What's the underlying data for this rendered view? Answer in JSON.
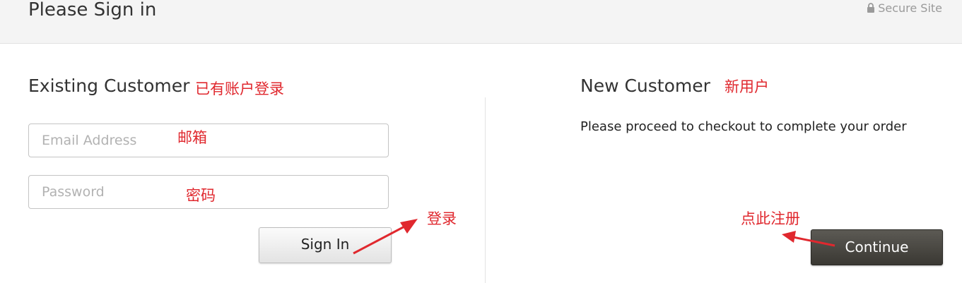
{
  "header": {
    "title": "Please Sign in",
    "secure_label": "Secure Site",
    "secure_icon": "lock-icon"
  },
  "existing": {
    "heading": "Existing Customer",
    "annotation": "已有账户登录",
    "email_placeholder": "Email Address",
    "email_annotation": "邮箱",
    "password_placeholder": "Password",
    "password_annotation": "密码",
    "signin_label": "Sign In",
    "signin_annotation": "登录"
  },
  "new_customer": {
    "heading": "New Customer",
    "annotation": "新用户",
    "description": "Please proceed to checkout to complete your order",
    "continue_label": "Continue",
    "continue_annotation": "点此注册"
  },
  "colors": {
    "annotation": "#e0282e",
    "continue_bg": "#3f3d38",
    "header_bg": "#f4f4f4"
  }
}
